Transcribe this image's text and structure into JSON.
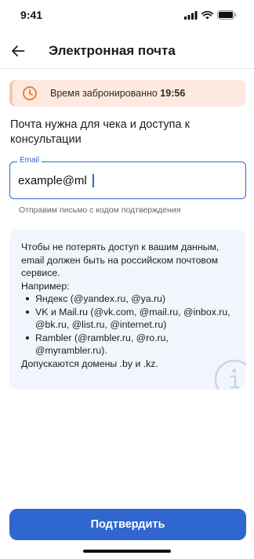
{
  "status_bar": {
    "time": "9:41"
  },
  "header": {
    "title": "Электронная почта"
  },
  "timer": {
    "text": "Время забронированно ",
    "time": "19:56"
  },
  "intro_text": "Почта нужна для чека и доступа к консультации",
  "email_field": {
    "label": "Email",
    "value": "example@ml"
  },
  "helper_text": "Отправим письмо с кодом подтверждения",
  "info": {
    "intro": "Чтобы не потерять доступ к вашим данным, email должен быть на российском почтовом сервисе.",
    "example_heading": "Например:",
    "items": [
      "Яндекс (@yandex.ru, @ya.ru)",
      "VK и Mail.ru (@vk.com, @mail.ru, @inbox.ru, @bk.ru, @list.ru, @internet.ru)",
      "Rambler (@rambler.ru, @ro.ru, @myrambler.ru)."
    ],
    "footer": "Допускаются домены .by и .kz."
  },
  "confirm_button": {
    "label": "Подтвердить"
  },
  "colors": {
    "accent": "#2f66d0",
    "timer_bg": "#fde9df",
    "timer_icon": "#e8763a",
    "info_bg": "#f2f6fc"
  },
  "icons": {
    "back": "arrow-left-icon",
    "timer": "clock-icon",
    "info": "info-icon",
    "signal": "signal-icon",
    "wifi": "wifi-icon",
    "battery": "battery-icon"
  }
}
